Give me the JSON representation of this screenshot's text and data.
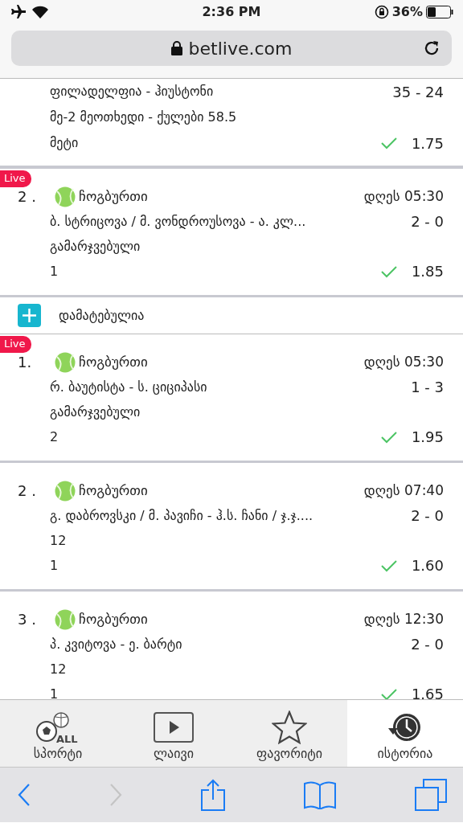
{
  "status_bar": {
    "time": "2:36 PM",
    "battery": "36%"
  },
  "address_bar": {
    "url": "betlive.com"
  },
  "items": [
    {
      "kind": "bet",
      "teams": "ფილადელფია - ჰიუსტონი",
      "score": "35 - 24",
      "market": "მე-2 მეოთხედი - ქულები 58.5",
      "selection": "მეტი",
      "odds": "1.75",
      "won": true
    },
    {
      "kind": "bet",
      "badge": "Live",
      "number": "2 .",
      "sport": "ჩოგბურთი",
      "time": "დღეს 05:30",
      "teams": "ბ. სტრიცოვა / მ. ვონდროუსოვა - ა. კლ...",
      "score": "2 - 0",
      "market": "გამარჯვებული",
      "selection": "1",
      "odds": "1.85",
      "won": true
    },
    {
      "kind": "notice",
      "label": "დამატებულია"
    },
    {
      "kind": "bet",
      "badge": "Live",
      "number": "1.",
      "sport": "ჩოგბურთი",
      "time": "დღეს 05:30",
      "teams": "რ. ბაუტისტა - ს. ციციპასი",
      "score": "1 - 3",
      "market": "გამარჯვებული",
      "selection": "2",
      "odds": "1.95",
      "won": true
    },
    {
      "kind": "bet",
      "number": "2 .",
      "sport": "ჩოგბურთი",
      "time": "დღეს 07:40",
      "teams": "გ. დაბროვსკი / მ. პავიჩი - ჰ.ს. ჩანი / ჯ.ჯ....",
      "score": "2 - 0",
      "market": "12",
      "selection": "1",
      "odds": "1.60",
      "won": true
    },
    {
      "kind": "bet",
      "number": "3 .",
      "sport": "ჩოგბურთი",
      "time": "დღეს 12:30",
      "teams": "პ. კვიტოვა - ე. ბარტი",
      "score": "2 - 0",
      "market": "12",
      "selection": "1",
      "odds": "1.65",
      "won": true
    }
  ],
  "tabs": [
    {
      "kind": "all",
      "icon_text": "ALL",
      "label": "სპორტი",
      "selected": false
    },
    {
      "kind": "live",
      "label": "ლაივი",
      "selected": false
    },
    {
      "kind": "star",
      "label": "ფავორიტი",
      "selected": false
    },
    {
      "kind": "history",
      "label": "ისტორია",
      "selected": true
    }
  ],
  "browser_toolbar": {
    "back_enabled": true,
    "forward_enabled": false
  }
}
